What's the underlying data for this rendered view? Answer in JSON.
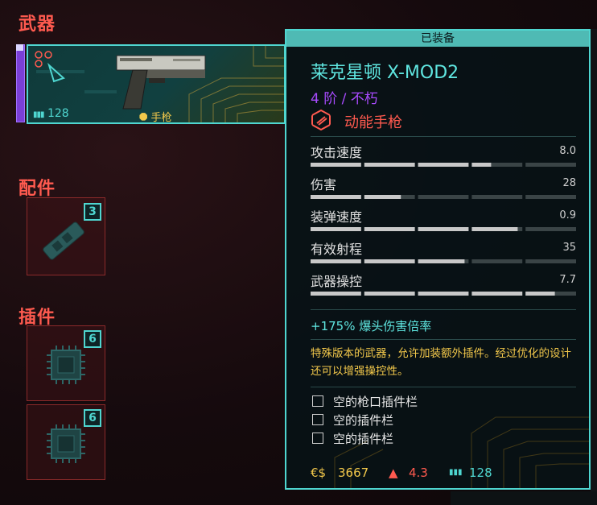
{
  "sections": {
    "weapon": "武器",
    "attachments": "配件",
    "mods": "插件"
  },
  "weapon_slot": {
    "ammo": "128",
    "category": "手枪"
  },
  "attachment_slot": {
    "count": "3"
  },
  "mod_slots": [
    {
      "count": "6"
    },
    {
      "count": "6"
    }
  ],
  "tooltip": {
    "header": "已装备",
    "name": "莱克星顿 X-MOD2",
    "tier": "4 阶 / 不朽",
    "type": "动能手枪",
    "stats": [
      {
        "label": "攻击速度",
        "value": "8.0",
        "fill": 0.68
      },
      {
        "label": "伤害",
        "value": "28",
        "fill": 0.34
      },
      {
        "label": "装弹速度",
        "value": "0.9",
        "fill": 0.78
      },
      {
        "label": "有效射程",
        "value": "35",
        "fill": 0.58
      },
      {
        "label": "武器操控",
        "value": "7.7",
        "fill": 0.92
      }
    ],
    "bonus": "+175% 爆头伤害倍率",
    "description": "特殊版本的武器，允许加装额外插件。经过优化的设计还可以增强操控性。",
    "mods": [
      "空的枪口插件栏",
      "空的插件栏",
      "空的插件栏"
    ],
    "footer": {
      "price": "3667",
      "weight": "4.3",
      "ammo": "128"
    }
  },
  "colors": {
    "accent": "#4fd6d0",
    "warning": "#ff5a4f",
    "legendary": "#a94bff",
    "gold": "#f2c84b"
  }
}
